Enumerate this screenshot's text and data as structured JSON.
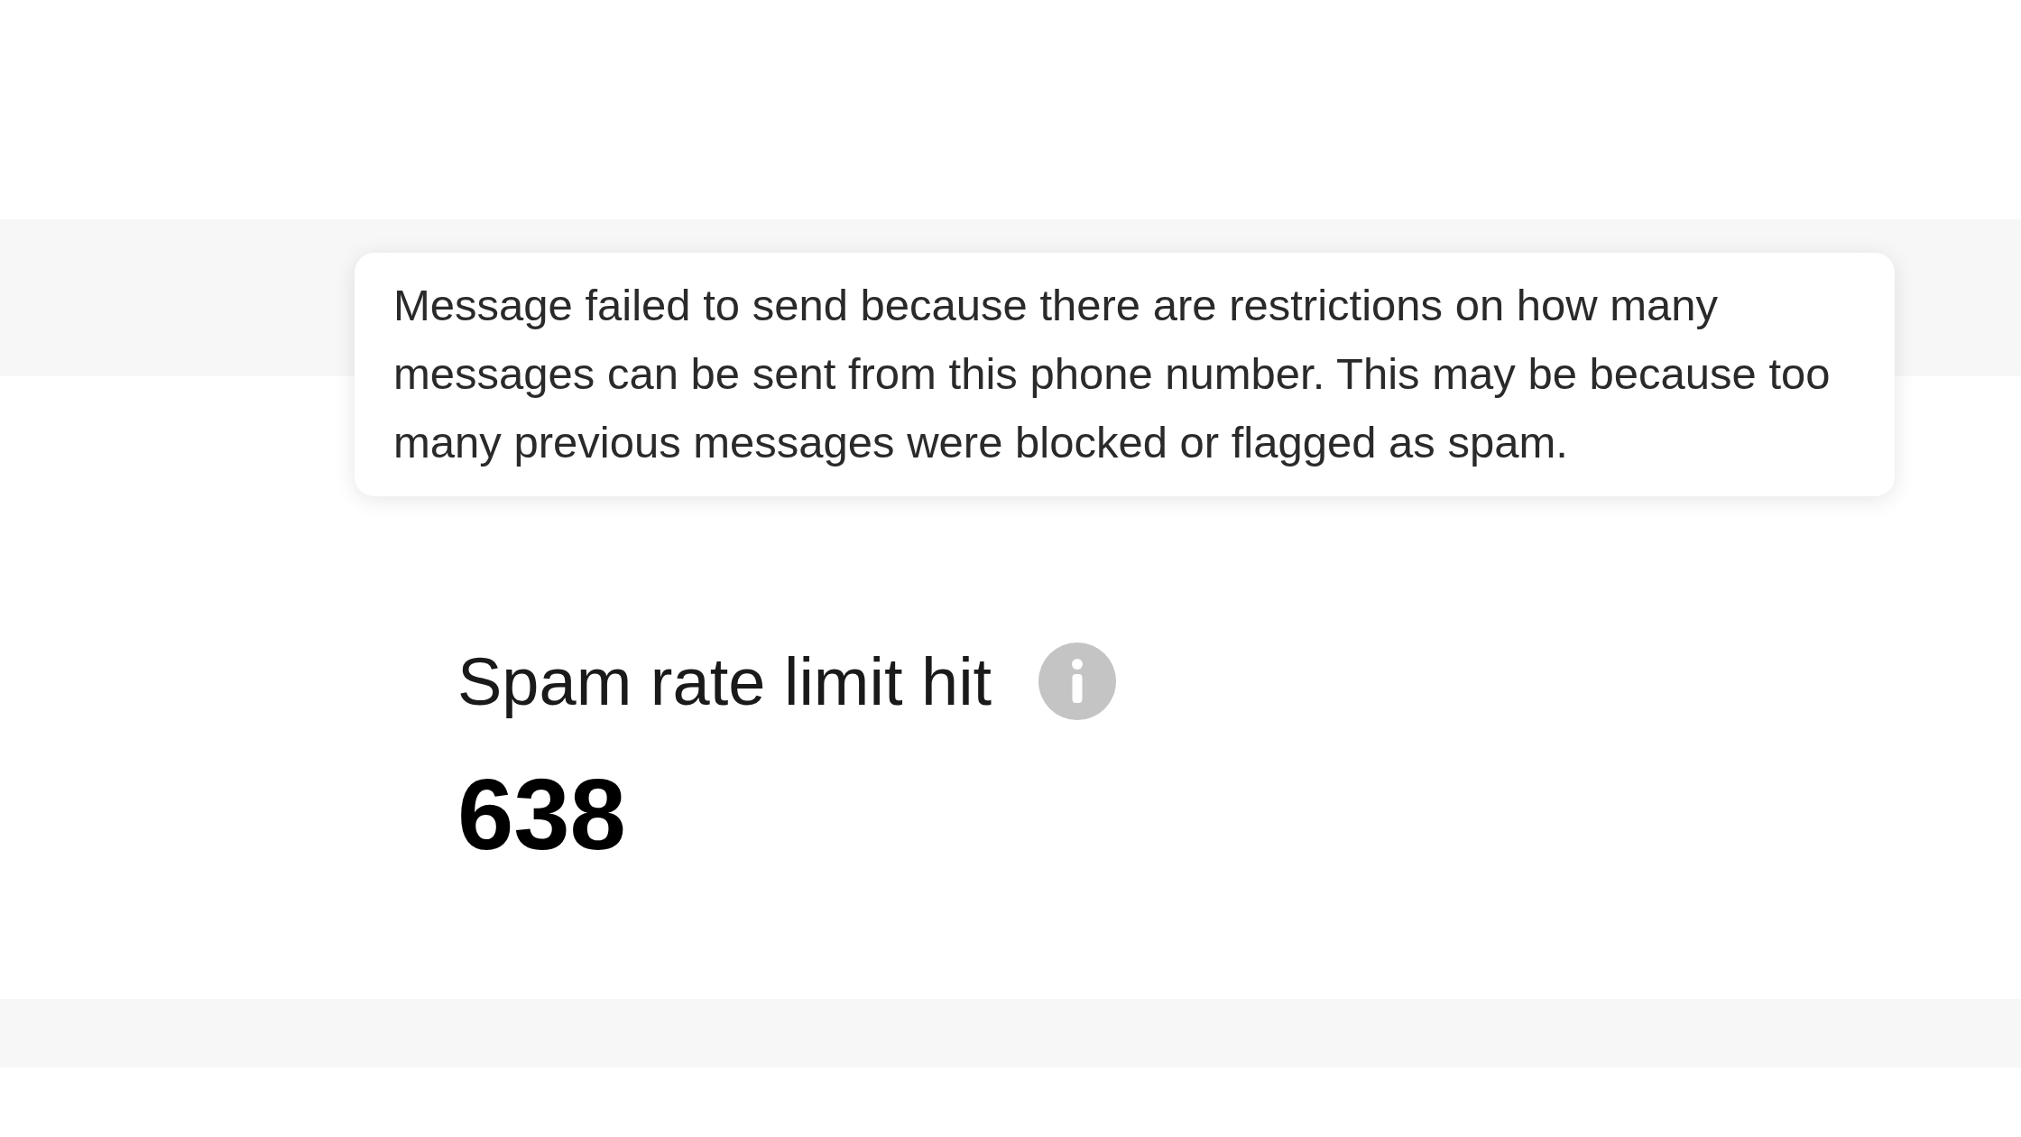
{
  "tooltip": {
    "text": "Message failed to send because there are restrictions on how many messages can be sent from this phone number. This may be because too many previous messages were blocked or flagged as spam."
  },
  "stat": {
    "label": "Spam rate limit hit",
    "value": "638"
  }
}
